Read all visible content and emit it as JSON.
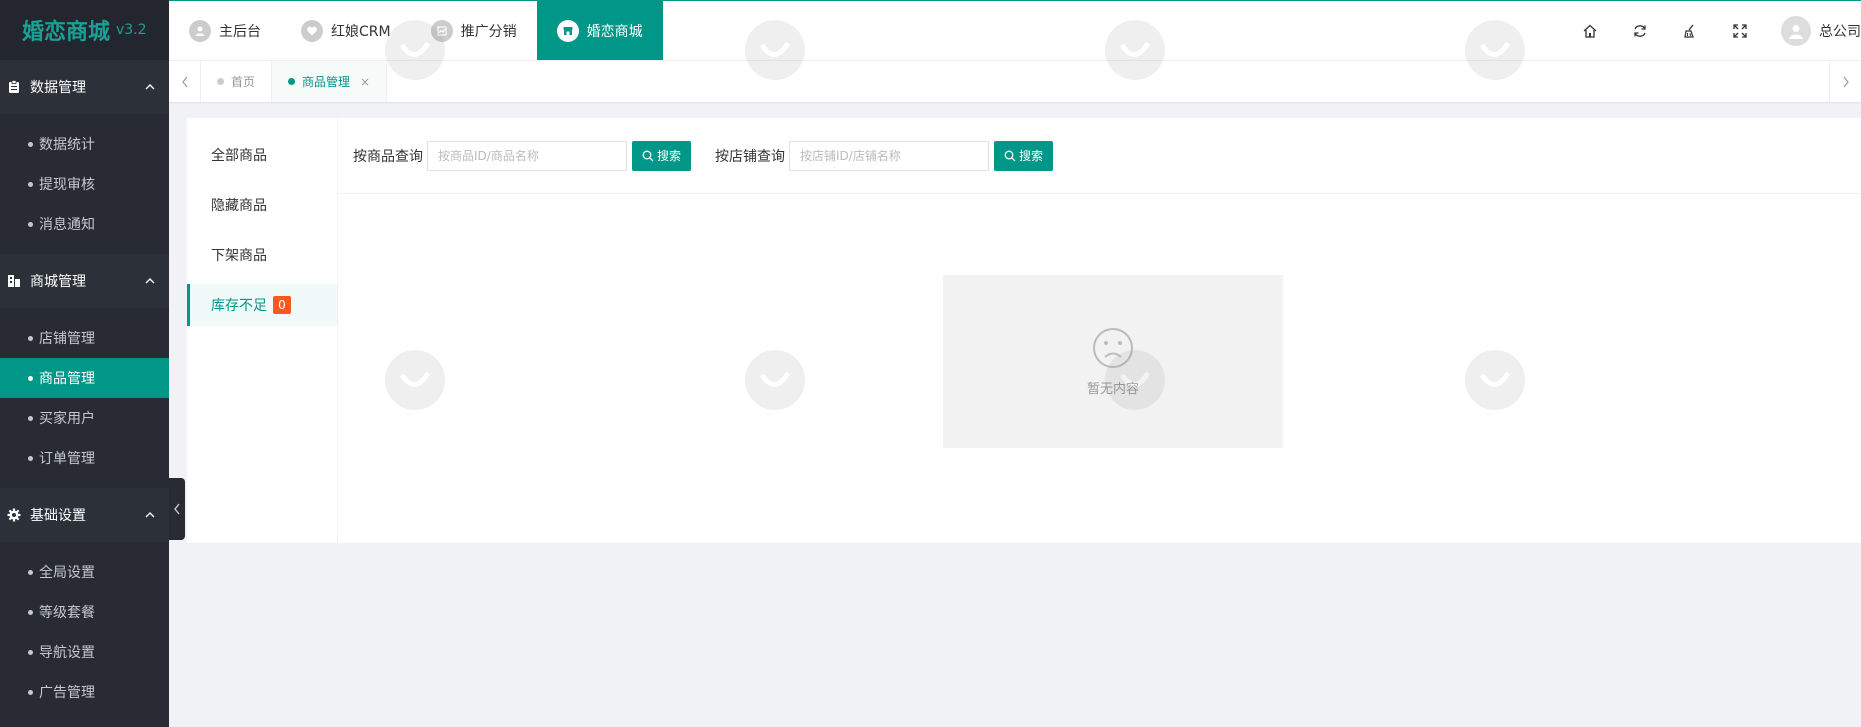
{
  "app": {
    "name": "婚恋商城",
    "version": "v3.2"
  },
  "sidebar": {
    "groups": [
      {
        "title": "数据管理",
        "icon": "clipboard-icon",
        "items": [
          {
            "label": "数据统计"
          },
          {
            "label": "提现审核"
          },
          {
            "label": "消息通知"
          }
        ]
      },
      {
        "title": "商城管理",
        "icon": "shop-icon",
        "items": [
          {
            "label": "店铺管理"
          },
          {
            "label": "商品管理"
          },
          {
            "label": "买家用户"
          },
          {
            "label": "订单管理"
          }
        ]
      },
      {
        "title": "基础设置",
        "icon": "gear-icon",
        "items": [
          {
            "label": "全局设置"
          },
          {
            "label": "等级套餐"
          },
          {
            "label": "导航设置"
          },
          {
            "label": "广告管理"
          }
        ]
      }
    ],
    "active_item": "商品管理"
  },
  "header": {
    "tabs": [
      {
        "label": "主后台"
      },
      {
        "label": "红娘CRM"
      },
      {
        "label": "推广分销"
      },
      {
        "label": "婚恋商城"
      }
    ],
    "active_tab": "婚恋商城",
    "icons": [
      "home-icon",
      "refresh-icon",
      "clear-icon",
      "fullscreen-icon"
    ],
    "user": "总公司"
  },
  "tabbar": {
    "tabs": [
      {
        "label": "首页"
      },
      {
        "label": "商品管理",
        "close": "×"
      }
    ]
  },
  "content": {
    "left_nav": [
      {
        "label": "全部商品"
      },
      {
        "label": "隐藏商品"
      },
      {
        "label": "下架商品"
      },
      {
        "label": "库存不足",
        "badge": "0"
      }
    ],
    "search": {
      "product_label": "按商品查询",
      "product_placeholder": "按商品ID/商品名称",
      "shop_label": "按店铺查询",
      "shop_placeholder": "按店铺ID/店铺名称",
      "button_label": "搜索"
    },
    "empty_text": "暂无内容"
  },
  "colors": {
    "accent": "#009688",
    "sidebar_bg": "#282b33",
    "badge": "#ff5722"
  }
}
